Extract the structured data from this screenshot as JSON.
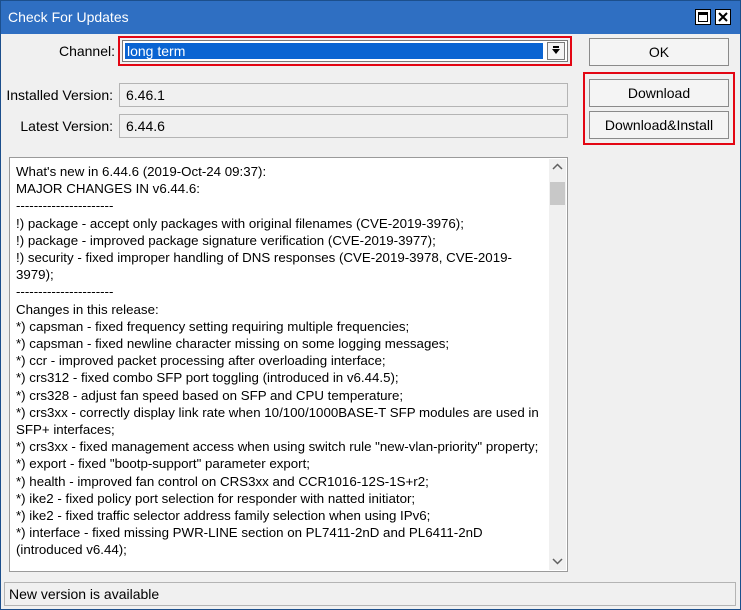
{
  "window": {
    "title": "Check For Updates"
  },
  "form": {
    "channel_label": "Channel:",
    "channel_value": "long term",
    "installed_label": "Installed Version:",
    "installed_value": "6.46.1",
    "latest_label": "Latest Version:",
    "latest_value": "6.44.6"
  },
  "buttons": {
    "ok": "OK",
    "download": "Download",
    "download_install": "Download&Install"
  },
  "notes": {
    "lines": [
      "What's new in 6.44.6 (2019-Oct-24 09:37):",
      "",
      "MAJOR CHANGES IN v6.44.6:",
      "----------------------",
      "!) package - accept only packages with original filenames (CVE-2019-3976);",
      "!) package - improved package signature verification (CVE-2019-3977);",
      "!) security - fixed improper handling of DNS responses (CVE-2019-3978, CVE-2019-3979);",
      "----------------------",
      "",
      "Changes in this release:",
      "",
      "*) capsman - fixed frequency setting requiring multiple frequencies;",
      "*) capsman - fixed newline character missing on some logging messages;",
      "*) ccr - improved packet processing after overloading interface;",
      "*) crs312 - fixed combo SFP port toggling (introduced in v6.44.5);",
      "*) crs328 - adjust fan speed based on SFP and CPU temperature;",
      "*) crs3xx - correctly display link rate when 10/100/1000BASE-T SFP modules are used in SFP+ interfaces;",
      "*) crs3xx - fixed management access when using switch rule \"new-vlan-priority\" property;",
      "*) export - fixed \"bootp-support\" parameter export;",
      "*) health - improved fan control on CRS3xx and CCR1016-12S-1S+r2;",
      "*) ike2 - fixed policy port selection for responder with natted initiator;",
      "*) ike2 - fixed traffic selector address family selection when using IPv6;",
      "*) interface - fixed missing PWR-LINE section on PL7411-2nD and PL6411-2nD (introduced v6.44);"
    ]
  },
  "status": {
    "text": "New version is available"
  },
  "colors": {
    "titlebar": "#2f6fc2",
    "highlight": "#e30613",
    "selection": "#0a64d2"
  }
}
